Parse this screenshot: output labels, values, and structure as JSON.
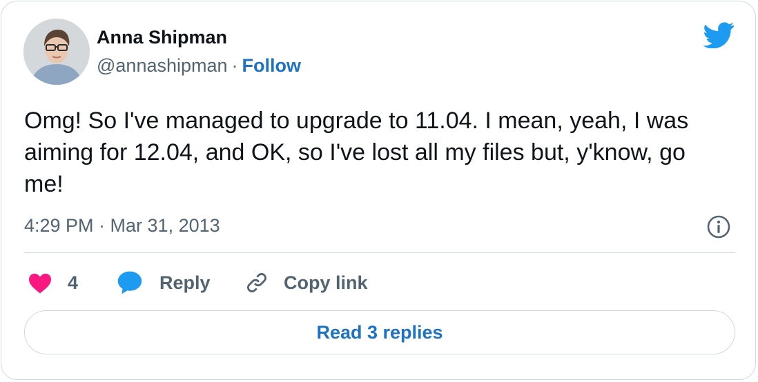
{
  "author": {
    "name": "Anna Shipman",
    "handle": "@annashipman",
    "separator": "·",
    "follow_label": "Follow"
  },
  "tweet": {
    "text": "Omg! So I've managed to upgrade to 11.04. I mean, yeah, I was aiming for 12.04, and OK, so I've lost all my files but, y'know, go me!",
    "timestamp": "4:29 PM · Mar 31, 2013"
  },
  "actions": {
    "like_count": "4",
    "reply_label": "Reply",
    "copy_link_label": "Copy link"
  },
  "read_replies_label": "Read 3 replies",
  "colors": {
    "twitter_blue": "#1d9bf0",
    "link_blue": "#1d72c4",
    "heart_pink": "#f91880",
    "muted_text": "#536471",
    "border": "#cfd9de"
  },
  "icons": [
    "twitter-bird-icon",
    "info-icon",
    "heart-icon",
    "reply-bubble-icon",
    "link-icon"
  ]
}
